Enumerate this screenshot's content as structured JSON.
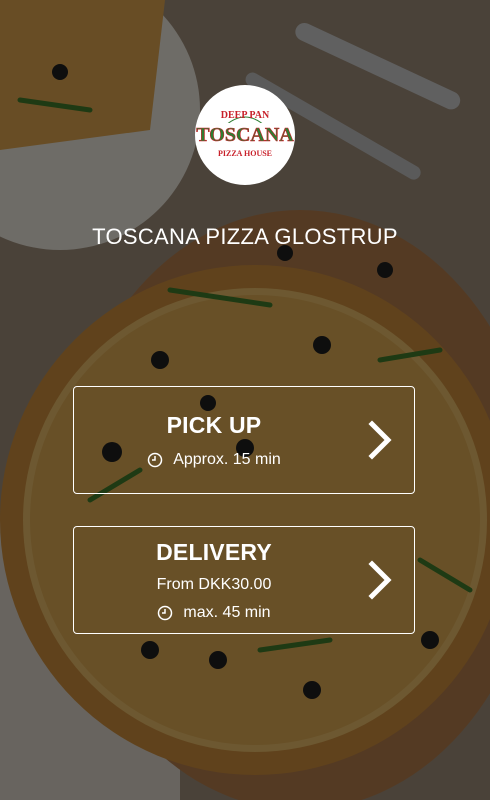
{
  "brand": {
    "logo_top": "DEEP PAN",
    "logo_main": "TOSCANA",
    "logo_bottom": "PIZZA HOUSE"
  },
  "restaurant_name": "TOSCANA PIZZA GLOSTRUP",
  "pickup": {
    "label": "PICK UP",
    "time": "Approx. 15 min",
    "icon": "clock-icon"
  },
  "delivery": {
    "label": "DELIVERY",
    "fee": "From DKK30.00",
    "time": "max. 45 min",
    "icon": "clock-icon"
  },
  "colors": {
    "logo_red": "#c8202a",
    "logo_green": "#2e7d32",
    "text": "#ffffff"
  }
}
